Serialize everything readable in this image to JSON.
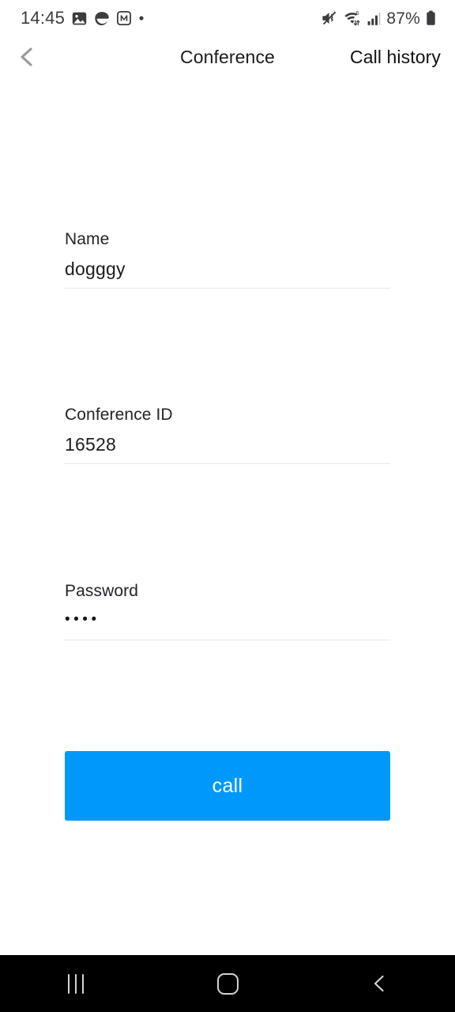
{
  "status_bar": {
    "clock": "14:45",
    "battery_percent": "87%",
    "left_icons": [
      "gallery-icon",
      "disc-notification-icon",
      "messenger-m-icon",
      "dot-indicator-icon"
    ],
    "right_icons": [
      "volume-mute-vibrate-icon",
      "wifi-6-icon",
      "cellular-signal-icon",
      "battery-icon"
    ],
    "text_color": "#3c3c40"
  },
  "header": {
    "back_label": "",
    "title": "Conference",
    "call_history_label": "Call history",
    "back_icon": "chevron-left-icon",
    "back_icon_color": "#9a9a9e",
    "title_color": "#1b1b1f"
  },
  "form": {
    "fields": [
      {
        "label": "Name",
        "value": "dogggy",
        "masked": false,
        "type": "text"
      },
      {
        "label": "Conference ID",
        "value": "16528",
        "masked": false,
        "type": "number"
      },
      {
        "label": "Password",
        "value": "••••",
        "masked": true,
        "type": "password"
      }
    ],
    "underline_color": "#e7e8ea"
  },
  "primary_action": {
    "label": "call",
    "background": "#0099fb",
    "text_color": "#ffffff"
  },
  "nav_bar": {
    "background": "#000000",
    "icon_color": "#d3d3d3",
    "buttons": [
      {
        "name": "recents",
        "icon": "recents-bars-icon"
      },
      {
        "name": "home",
        "icon": "home-square-icon"
      },
      {
        "name": "back",
        "icon": "chevron-left-icon"
      }
    ]
  }
}
